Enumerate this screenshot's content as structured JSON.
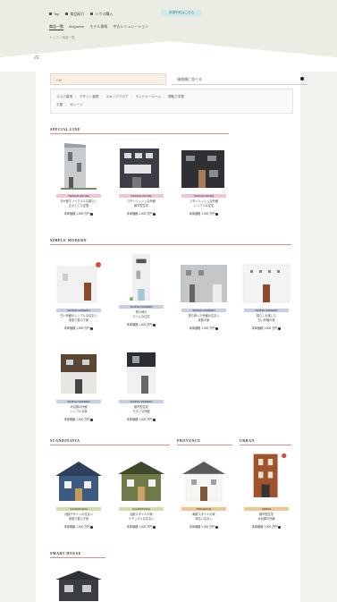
{
  "header": {
    "topnav": [
      "Top",
      "商品紹介",
      "ハウス購入"
    ],
    "reserve_label": "来場予約はこちら",
    "subnav": [
      "商品一覧",
      "Magazine",
      "モデル情報",
      "中古シミュレーション"
    ],
    "breadcrumb": "トップ > 商品一覧",
    "logo": "ZE"
  },
  "search": {
    "keyword_label": "CM",
    "sort_label": "価格順に並べる"
  },
  "filters": [
    "コスパ重視",
    "デザイン重視",
    "スキップフロア",
    "ランドリールーム",
    "間取り変更",
    "平屋",
    "ガレージ"
  ],
  "sections": {
    "special": "SPECIAL LINE",
    "simple": "SIMPLE MODERN",
    "scandinavia": "SCANDINAVIA",
    "provence": "PROVENCE",
    "urban": "URBAN",
    "smart": "SMART HOUSE"
  },
  "special_cards": [
    {
      "tag": "DESIGN HOUSE",
      "desc_1": "光が差すハイクラスな暮らし",
      "desc_2": "広々とした空間",
      "price": "本体価格 1,000 万円"
    },
    {
      "tag": "DESIGN HOUSE",
      "desc_1": "スタイリッシュな外観",
      "desc_2": "都市型住宅",
      "price": "本体価格 1,000 万円"
    },
    {
      "tag": "SINGLE HOUSE",
      "desc_1": "スタイリッシュな外観",
      "desc_2": "シンプルな住宅",
      "price": "本体価格 1,000 万円"
    }
  ],
  "simple_cards": [
    {
      "tag": "SIMPLE MODERN",
      "desc_1": "白い外観のシンプルな住まい",
      "desc_2": "家族で暮らす家",
      "price": "本体価格 1,000 万円"
    },
    {
      "tag": "SIMPLE MODERN",
      "desc_1": "狭小地の",
      "desc_2": "スリムな住宅",
      "price": "本体価格 1,000 万円"
    },
    {
      "tag": "SIMPLE MODERN",
      "desc_1": "落ち着いた外観の住まい",
      "desc_2": "家族の家",
      "price": "本体価格 1,000 万円"
    },
    {
      "tag": "SIMPLE MODERN",
      "desc_1": "暮らしを楽しむ",
      "desc_2": "白い外観の家",
      "price": "本体価格 1,000 万円"
    },
    {
      "tag": "SIMPLE MODERN",
      "desc_1": "木目調の外観",
      "desc_2": "シンプルな家",
      "price": "本体価格 1,000 万円"
    },
    {
      "tag": "SIMPLE MODERN",
      "desc_1": "都市型住宅",
      "desc_2": "モダンな外観",
      "price": "本体価格 1,000 万円"
    }
  ],
  "lower_cards": [
    {
      "tag": "SCANDINAVIA",
      "desc_1": "北欧デザインの住まい",
      "desc_2": "家族で暮らす家",
      "price": "本体価格 1,000 万円"
    },
    {
      "tag": "SCANDINAVIA",
      "desc_1": "北欧スタイルの家",
      "desc_2": "ナチュラルな住まい",
      "price": "本体価格 1,000 万円"
    },
    {
      "tag": "PROVENCE",
      "desc_1": "南欧スタイルの家",
      "desc_2": "明るい住まい",
      "price": "本体価格 1,000 万円"
    },
    {
      "tag": "URBAN",
      "desc_1": "都市型住宅",
      "desc_2": "木目調の外観",
      "price": "本体価格 1,000 万円"
    }
  ],
  "colors": {
    "accent": "#e08a8a",
    "pink_tag": "#f2c3d6",
    "blue_tag": "#c7cfe8",
    "green_tag": "#c9e0a9",
    "orange_tag": "#f4c48e"
  }
}
